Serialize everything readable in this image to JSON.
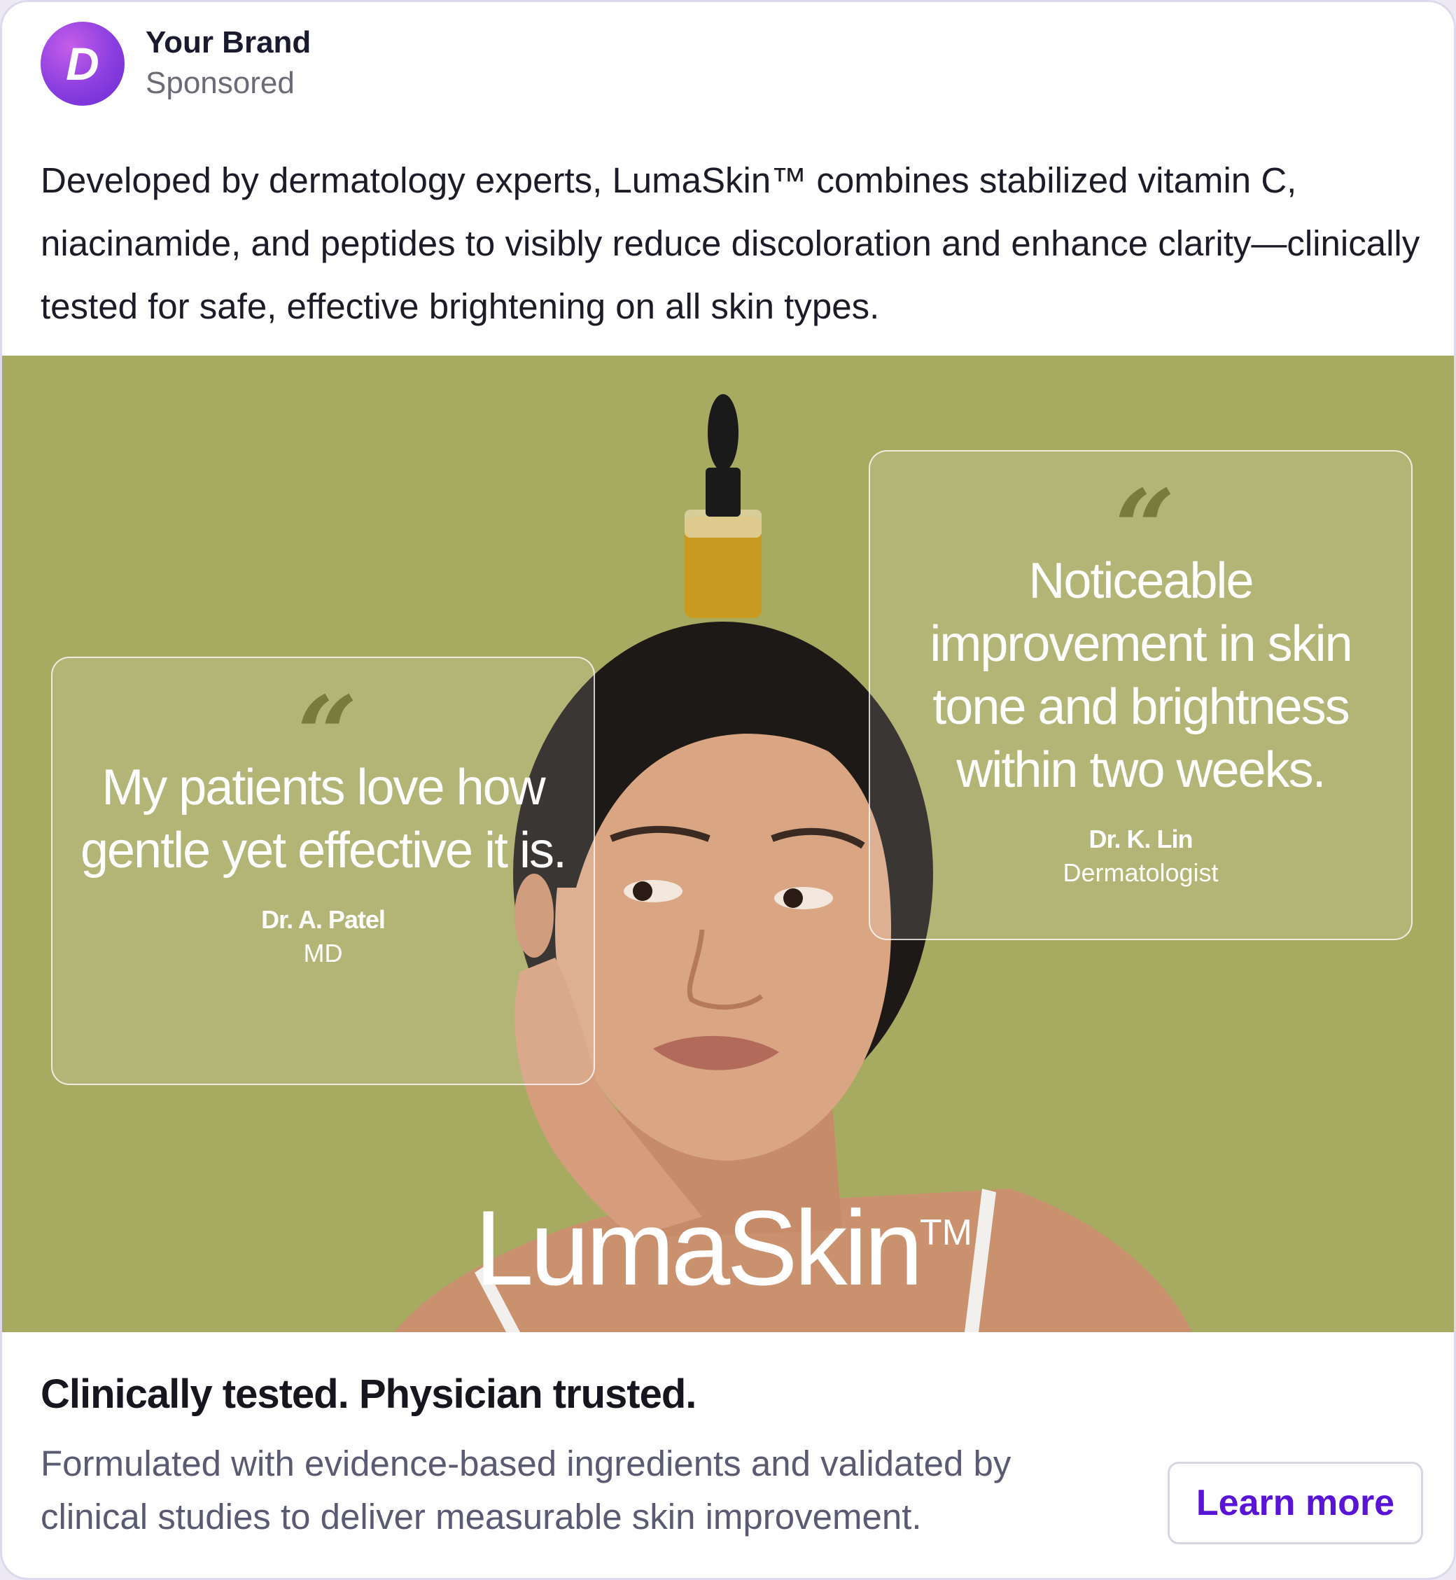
{
  "post": {
    "avatar_letter": "D",
    "brand_name": "Your Brand",
    "sponsored_label": "Sponsored",
    "body_text": "Developed by dermatology experts, LumaSkin™ combines stabilized vitamin C, niacinamide, and peptides to visibly reduce discoloration and enhance clarity—clinically tested for safe, effective brightening on all skin types."
  },
  "hero": {
    "background_color": "#a7ab62",
    "testimonials": [
      {
        "quote": "My patients love how gentle yet effective it is.",
        "author": "Dr. A. Patel",
        "role": "MD"
      },
      {
        "quote": "Noticeable improvement in skin tone and brightness within two weeks.",
        "author": "Dr. K. Lin",
        "role": "Dermatologist"
      }
    ],
    "logo_text": "LumaSkin",
    "logo_mark": "TM"
  },
  "footer": {
    "headline": "Clinically tested. Physician trusted.",
    "description": "Formulated with evidence-based ingredients and validated by clinical studies to deliver measurable skin improvement.",
    "cta_label": "Learn more",
    "cta_color": "#5a14d6"
  }
}
